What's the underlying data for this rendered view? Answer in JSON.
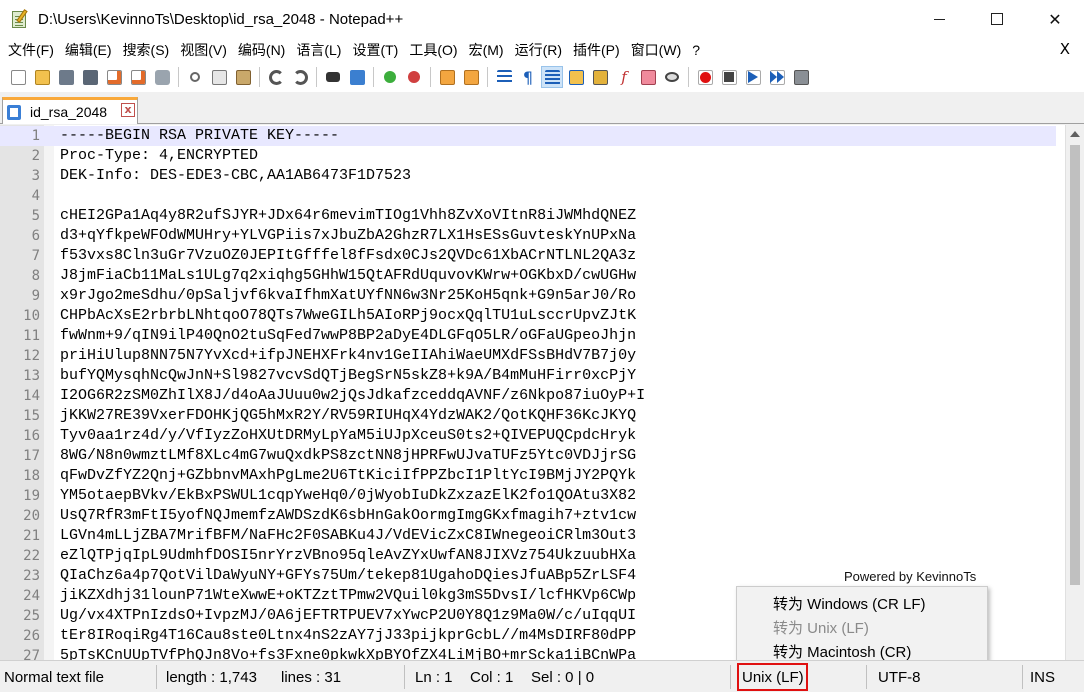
{
  "window": {
    "title": "D:\\Users\\KevinnoTs\\Desktop\\id_rsa_2048 - Notepad++",
    "controls": {
      "minimize": "minimize",
      "maximize": "maximize",
      "close": "✕"
    }
  },
  "menu": {
    "items": [
      "文件(F)",
      "编辑(E)",
      "搜索(S)",
      "视图(V)",
      "编码(N)",
      "语言(L)",
      "设置(T)",
      "工具(O)",
      "宏(M)",
      "运行(R)",
      "插件(P)",
      "窗口(W)",
      "?"
    ],
    "close": "X"
  },
  "toolbar": {
    "icons": [
      "new-file-icon",
      "open-file-icon",
      "save-icon",
      "save-all-icon",
      "close-icon",
      "close-all-icon",
      "print-icon",
      "cut-icon",
      "copy-icon",
      "paste-icon",
      "undo-icon",
      "redo-icon",
      "find-icon",
      "replace-icon",
      "zoom-in-icon",
      "zoom-out-icon",
      "sync-vertical-icon",
      "sync-horizontal-icon",
      "word-wrap-icon",
      "show-all-chars-icon",
      "indent-guide-icon",
      "user-language-icon",
      "doc-map-icon",
      "function-list-icon",
      "folder-workspace-icon",
      "monitor-icon",
      "record-macro-icon",
      "stop-record-icon",
      "play-macro-icon",
      "run-macro-multiple-icon",
      "save-macro-icon"
    ],
    "colors": {
      "record": "#e01010",
      "play": "#1c5fb8"
    }
  },
  "tab": {
    "label": "id_rsa_2048",
    "accent": "#f9a93b",
    "close": "x"
  },
  "editor": {
    "lines": [
      "-----BEGIN RSA PRIVATE KEY-----",
      "Proc-Type: 4,ENCRYPTED",
      "DEK-Info: DES-EDE3-CBC,AA1AB6473F1D7523",
      "",
      "cHEI2GPa1Aq4y8R2ufSJYR+JDx64r6mevimTIOg1Vhh8ZvXoVItnR8iJWMhdQNEZ",
      "d3+qYfkpeWFOdWMUHry+YLVGPiis7xJbuZbA2GhzR7LX1HsESsGuvteskYnUPxNa",
      "f53vxs8Cln3uGr7VzuOZ0JEPItGfffel8fFsdx0CJs2QVDc61XbACrNTLNL2QA3z",
      "J8jmFiaCb11MaLs1ULg7q2xiqhg5GHhW15QtAFRdUquvovKWrw+OGKbxD/cwUGHw",
      "x9rJgo2meSdhu/0pSaljvf6kvaIfhmXatUYfNN6w3Nr25KoH5qnk+G9n5arJ0/Ro",
      "CHPbAcXsE2rbrbLNhtqoO78QTs7WweGILh5AIoRPj9ocxQqlTU1uLsccrUpvZJtK",
      "fwWnm+9/qIN9ilP40QnO2tuSqFed7wwP8BP2aDyE4DLGFqO5LR/oGFaUGpeoJhjn",
      "priHiUlup8NN75N7YvXcd+ifpJNEHXFrk4nv1GeIIAhiWaeUMXdFSsBHdV7B7j0y",
      "bufYQMysqhNcQwJnN+Sl9827vcvSdQTjBegSrN5skZ8+k9A/B4mMuHFirr0xcPjY",
      "I2OG6R2zSM0ZhIlX8J/d4oAaJUuu0w2jQsJdkafzceddqAVNF/z6Nkpo87iuOyP+I",
      "jKKW27RE39VxerFDOHKjQG5hMxR2Y/RV59RIUHqX4YdzWAK2/QotKQHF36KcJKYQ",
      "Tyv0aa1rz4d/y/VfIyzZoHXUtDRMyLpYaM5iUJpXceuS0ts2+QIVEPUQCpdcHryk",
      "8WG/N8n0wmztLMf8XLc4mG7wuQxdkPS8zctNN8jHPRFwUJvaTUFz5Ytc0VDJjrSG",
      "qFwDvZfYZ2Qnj+GZbbnvMAxhPgLme2U6TtKiciIfPPZbcI1PltYcI9BMjJY2PQYk",
      "YM5otaepBVkv/EkBxPSWUL1cqpYweHq0/0jWyobIuDkZxzazElK2fo1QOAtu3X82",
      "UsQ7RfR3mFtI5yofNQJmemfzAWDSzdK6sbHnGakOormgImgGKxfmagih7+ztv1cw",
      "LGVn4mLLjZBA7MrifBFM/NaFHc2F0SABKu4J/VdEVicZxC8IWnegeoiCRlm3Out3",
      "eZlQTPjqIpL9UdmhfDOSI5nrYrzVBno95qleAvZYxUwfAN8JIXVz754UkzuubHXa",
      "QIaChz6a4p7QotVilDaWyuNY+GFYs75Um/tekep81UgahoDQiesJfuABp5ZrLSF4",
      "jiKZXdhj31lounP71WteXwwE+oKTZztTPmw2VQuil0kg3mS5DvsI/lcfHKVp6CWp",
      "Ug/vx4XTPnIzdsO+IvpzMJ/0A6jEFTRTPUEV7xYwcP2U0Y8Q1z9Ma0W/c/uIqqUI",
      "tEr8IRoqiRg4T16Cau8ste0Ltnx4nS2zAY7jJ33pijkprGcbL//m4MsDIRF80dPP",
      "5pTsKCnUUpTVfPhQJn8Vo+fs3Fxne0pkwkXpBYOfZX4LiMjBO+mrScka1iBCnWPa"
    ],
    "numbers": [
      "1",
      "2",
      "3",
      "4",
      "5",
      "6",
      "7",
      "8",
      "9",
      "10",
      "11",
      "12",
      "13",
      "14",
      "15",
      "16",
      "17",
      "18",
      "19",
      "20",
      "21",
      "22",
      "23",
      "24",
      "25",
      "26",
      "27"
    ]
  },
  "overlay": {
    "powered_by": "Powered by KevinnoTs"
  },
  "context_menu": {
    "items": [
      {
        "label": "转为 Windows (CR LF)",
        "enabled": true
      },
      {
        "label": "转为 Unix (LF)",
        "enabled": false
      },
      {
        "label": "转为 Macintosh (CR)",
        "enabled": true
      }
    ]
  },
  "status": {
    "type": "Normal text file",
    "length": "length : 1,743",
    "lines": "lines : 31",
    "ln": "Ln : 1",
    "col": "Col : 1",
    "sel": "Sel : 0 | 0",
    "eol": "Unix (LF)",
    "encoding": "UTF-8",
    "mode": "INS",
    "highlight_color": "#e01010"
  }
}
